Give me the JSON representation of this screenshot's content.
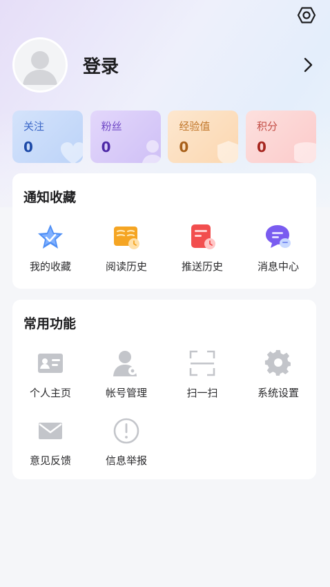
{
  "header": {
    "settings_icon": "settings-hexagon-icon",
    "login_label": "登录",
    "avatar_icon": "default-avatar-icon",
    "chevron_icon": "chevron-right-icon"
  },
  "stats": [
    {
      "label": "关注",
      "value": "0",
      "color": "#1d4aa8"
    },
    {
      "label": "粉丝",
      "value": "0",
      "color": "#4e29a6"
    },
    {
      "label": "经验值",
      "value": "0",
      "color": "#a8601a"
    },
    {
      "label": "积分",
      "value": "0",
      "color": "#a6261f"
    }
  ],
  "notify_section": {
    "title": "通知收藏",
    "items": [
      {
        "label": "我的收藏",
        "icon": "star-icon"
      },
      {
        "label": "阅读历史",
        "icon": "book-history-icon"
      },
      {
        "label": "推送历史",
        "icon": "push-history-icon"
      },
      {
        "label": "消息中心",
        "icon": "message-icon"
      }
    ]
  },
  "common_section": {
    "title": "常用功能",
    "items": [
      {
        "label": "个人主页",
        "icon": "id-card-icon"
      },
      {
        "label": "帐号管理",
        "icon": "account-manage-icon"
      },
      {
        "label": "扫一扫",
        "icon": "scan-icon"
      },
      {
        "label": "系统设置",
        "icon": "gear-icon"
      },
      {
        "label": "意见反馈",
        "icon": "mail-icon"
      },
      {
        "label": "信息举报",
        "icon": "report-icon"
      }
    ]
  }
}
